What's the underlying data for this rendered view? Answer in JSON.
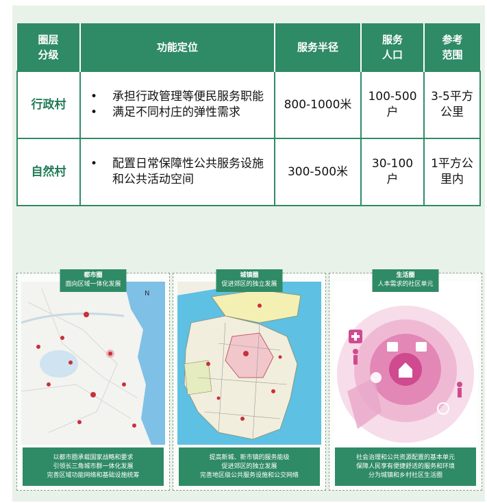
{
  "table": {
    "headers": [
      "圈层\n分级",
      "功能定位",
      "服务半径",
      "服务\n人口",
      "参考\n范围"
    ],
    "rows": [
      {
        "level": "行政村",
        "functions": [
          "承担行政管理等便民服务职能",
          "满足不同村庄的弹性需求"
        ],
        "radius": "800-1000米",
        "population": "100-500户",
        "range": "3-5平方公里"
      },
      {
        "level": "自然村",
        "functions": [
          "配置日常保障性公共服务设施和公共活动空间"
        ],
        "radius": "300-500米",
        "population": "30-100户",
        "range": "1平方公里内"
      }
    ]
  },
  "panels": [
    {
      "title": "都市圈",
      "subtitle": "面向区域一体化发展",
      "notes": [
        "以都市圈承载国家战略和要求",
        "引领长三角城市群一体化发展",
        "完善区域功能网络和基础设施统筹"
      ]
    },
    {
      "title": "城镇圈",
      "subtitle": "促进郊区的独立发展",
      "notes": [
        "提高新城、新市镇的服务能级",
        "促进郊区的独立发展",
        "完善地区级公共服务设施和公交网络"
      ]
    },
    {
      "title": "生活圈",
      "subtitle": "人本需求的社区单元",
      "notes": [
        "社会治理和公共资源配置的基本单元",
        "保障人民享有便捷舒适的服务和环境",
        "分为城镇和乡村社区生活圈"
      ]
    }
  ],
  "icons": [
    "house-icon",
    "shop-icon",
    "school-icon",
    "hospital-icon",
    "elderly-icon",
    "person-icon",
    "sports-icon",
    "heart-icon"
  ]
}
